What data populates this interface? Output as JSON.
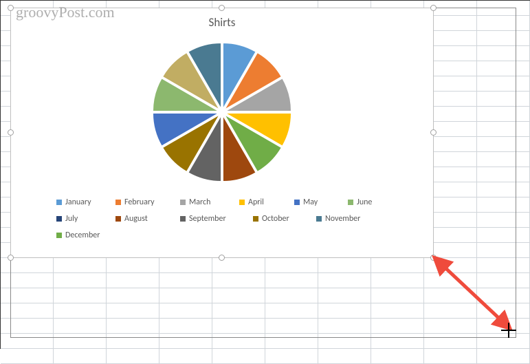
{
  "watermark": "groovyPost.com",
  "chart_data": {
    "type": "pie",
    "title": "Shirts",
    "categories": [
      "January",
      "February",
      "March",
      "April",
      "May",
      "June",
      "July",
      "August",
      "September",
      "October",
      "November",
      "December"
    ],
    "values": [
      8.3,
      8.3,
      8.3,
      8.3,
      8.3,
      8.3,
      8.3,
      8.3,
      8.3,
      8.3,
      8.3,
      8.3
    ],
    "colors": [
      "#5b9bd5",
      "#ed7d31",
      "#a5a5a5",
      "#ffc000",
      "#70ad47",
      "#9e480e",
      "#636363",
      "#997300",
      "#4472c4",
      "#8cb86e",
      "#c1ad63",
      "#4a7a91"
    ],
    "legend_position": "bottom",
    "exploded": true
  },
  "legend": {
    "items": [
      {
        "label": "January",
        "color": "#5b9bd5"
      },
      {
        "label": "February",
        "color": "#ed7d31"
      },
      {
        "label": "March",
        "color": "#a5a5a5"
      },
      {
        "label": "April",
        "color": "#ffc000"
      },
      {
        "label": "May",
        "color": "#4472c4"
      },
      {
        "label": "June",
        "color": "#8cb86e"
      },
      {
        "label": "July",
        "color": "#264478"
      },
      {
        "label": "August",
        "color": "#9e480e"
      },
      {
        "label": "September",
        "color": "#636363"
      },
      {
        "label": "October",
        "color": "#997300"
      },
      {
        "label": "November",
        "color": "#4a7a91"
      },
      {
        "label": "December",
        "color": "#70ad47"
      }
    ]
  }
}
